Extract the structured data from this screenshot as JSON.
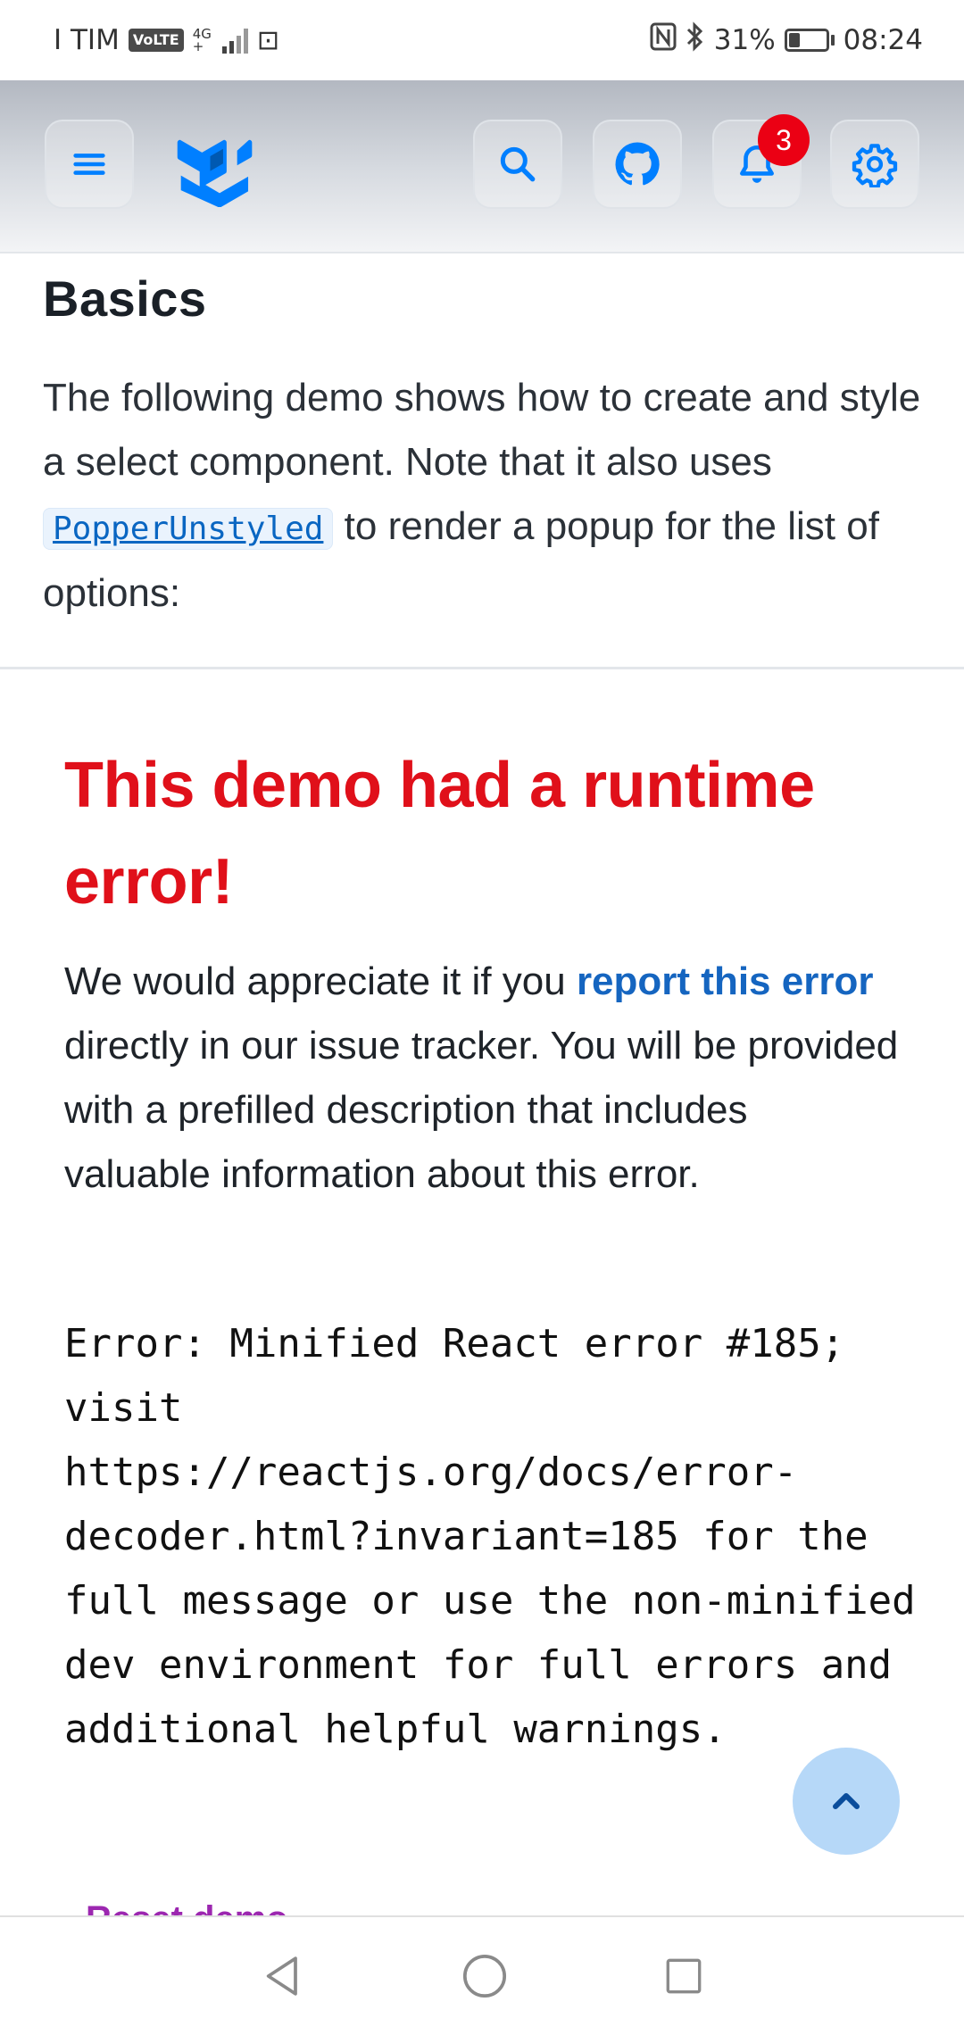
{
  "status_bar": {
    "carrier": "I TIM",
    "volte_label": "VoLTE",
    "network_type": "4G",
    "network_sub": "+",
    "extra_chip": "⊡",
    "battery_percent": "31%",
    "battery_level": 0.31,
    "time": "08:24"
  },
  "app_bar": {
    "notification_count": "3",
    "brand_color": "#007fff"
  },
  "content": {
    "section_title": "Basics",
    "intro_before": "The following demo shows how to create and style a select component. Note that it also uses ",
    "intro_code": "PopperUnstyled",
    "intro_after": " to render a popup for the list of options:"
  },
  "error": {
    "title": "This demo had a runtime error!",
    "body_before": "We would appreciate it if you ",
    "link_text": "report this error",
    "body_after": " directly in our issue tracker. You will be provided with a prefilled description that includes valuable information about this error.",
    "message": "Error: Minified React error #185; visit https://reactjs.org/docs/error-decoder.html?invariant=185 for the full message or use the non-minified dev environment for full errors and additional helpful warnings.",
    "reset_label": "Reset demo"
  },
  "colors": {
    "error_red": "#e0101a",
    "link_blue": "#1565c0",
    "reset_purple": "#9c27b0",
    "fab_bg": "#b6d8f8"
  }
}
